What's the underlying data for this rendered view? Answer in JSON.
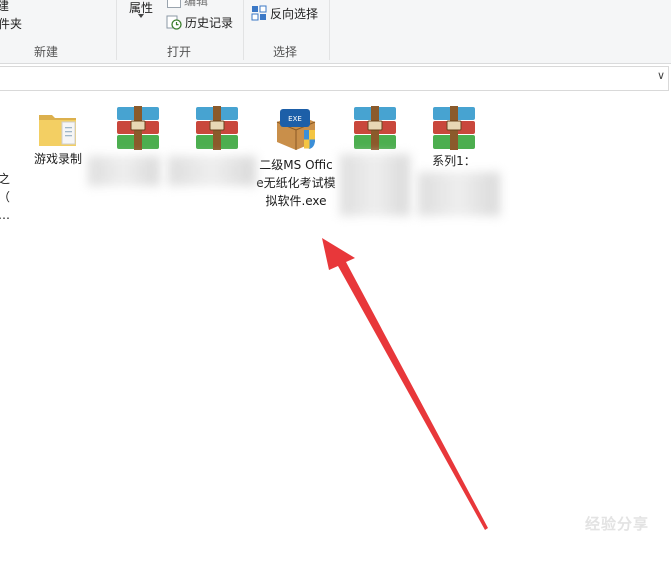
{
  "ribbon": {
    "new_group": {
      "partial_top": "建",
      "partial_bottom": "件夹",
      "label": "新建"
    },
    "open_group": {
      "properties_label": "属性",
      "edit_label": "编辑",
      "history_label": "历史记录",
      "label": "打开"
    },
    "select_group": {
      "invert_label": "反向选择",
      "label": "选择"
    }
  },
  "address_bar": {
    "value": ""
  },
  "left_partial": {
    "lines": [
      "之",
      "（",
      "…"
    ]
  },
  "files": [
    {
      "name": "游戏录制",
      "icon": "folder-icon"
    },
    {
      "name": "",
      "icon": "winrar-archive-icon"
    },
    {
      "name": "",
      "icon": "winrar-archive-icon"
    },
    {
      "name": "二级MS Office无纸化考试模拟软件.exe",
      "icon": "exe-installer-icon"
    },
    {
      "name": "",
      "icon": "winrar-archive-icon"
    },
    {
      "name": "系列1：",
      "icon": "winrar-archive-icon"
    }
  ],
  "annotation": {
    "color": "#e8373a",
    "icon": "red-arrow-annotation"
  },
  "watermark": {
    "text": "经验分享"
  }
}
